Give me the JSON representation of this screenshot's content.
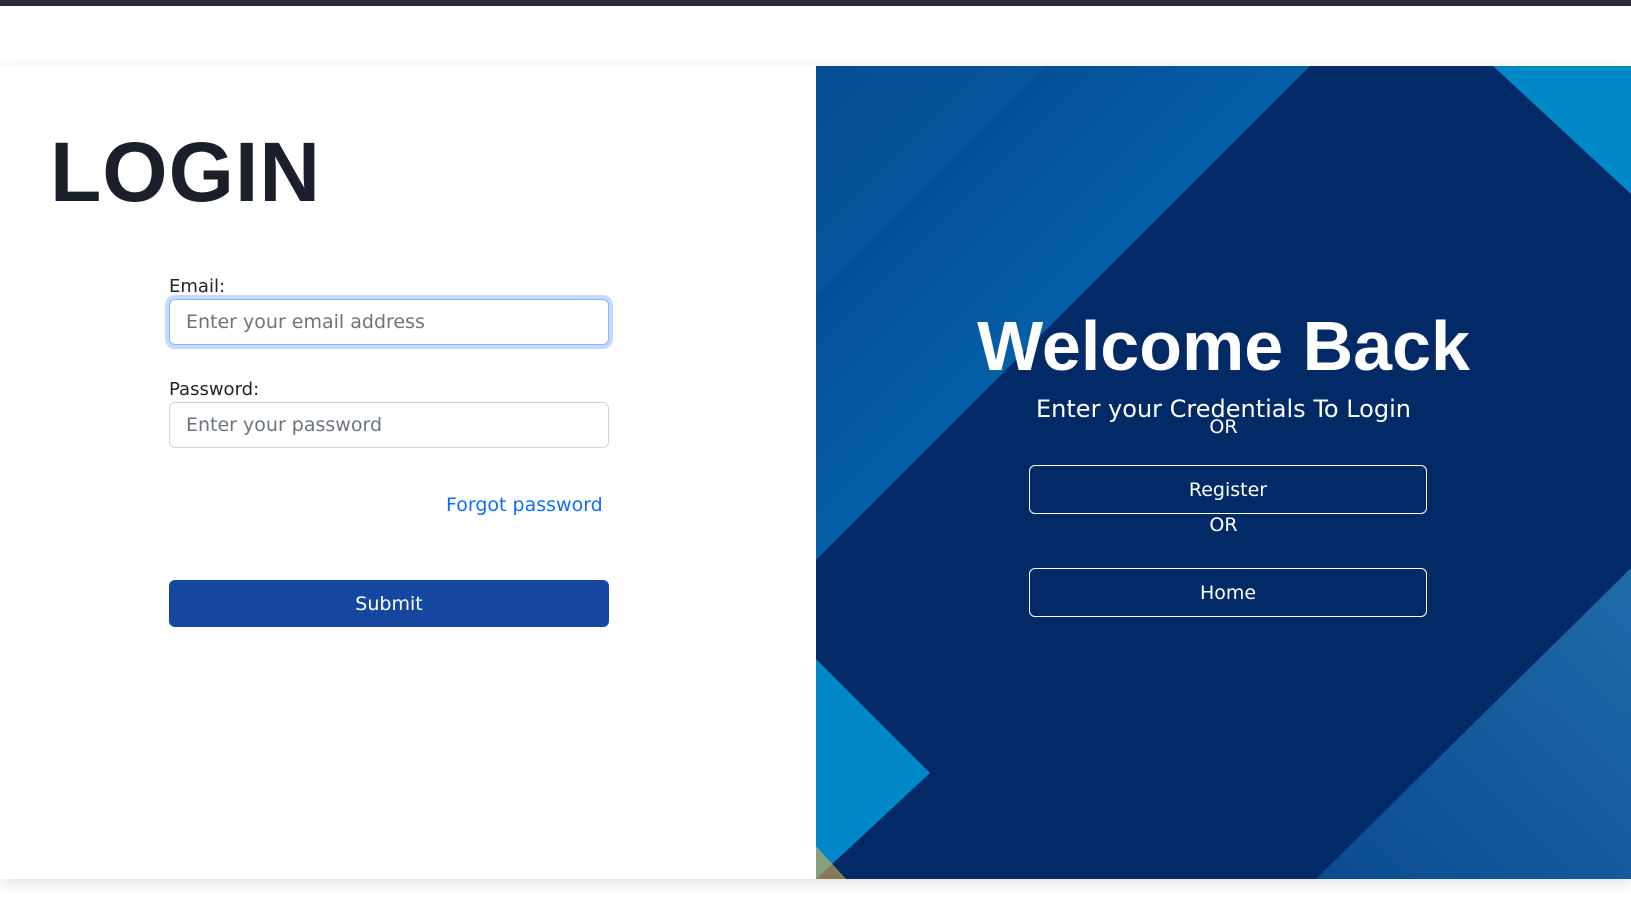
{
  "login": {
    "title": "LOGIN",
    "email_label": "Email:",
    "email_placeholder": "Enter your email address",
    "email_value": "",
    "password_label": "Password:",
    "password_placeholder": "Enter your password",
    "password_value": "",
    "forgot_link": "Forgot password",
    "submit_label": "Submit"
  },
  "welcome": {
    "heading": "Welcome Back",
    "subtitle": "Enter your Credentials To Login",
    "or_1": "OR",
    "register_label": "Register",
    "or_2": "OR",
    "home_label": "Home"
  },
  "colors": {
    "top_bar": "#2b2d3a",
    "submit_button": "#1547a0",
    "panel_navy": "#012a66",
    "panel_accent": "#0088c9",
    "link": "#0d6efd",
    "title_text": "#1b1f2a"
  }
}
